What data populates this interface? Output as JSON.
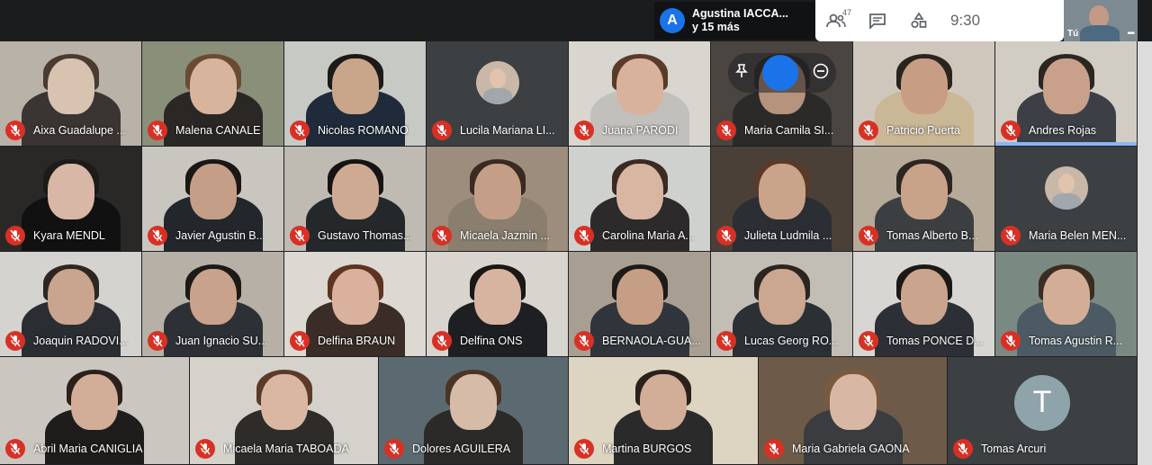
{
  "header": {
    "presenter_initial": "A",
    "presenter_name": "Agustina IACCA...",
    "presenter_more": "y 15 más",
    "participants_count": "47",
    "clock": "9:30",
    "self_label": "Tú",
    "self_more": "•••"
  },
  "hover_controls": {
    "pin_icon": "pin-icon",
    "mute_icon": "remove-circle-icon"
  },
  "participants": [
    {
      "name": "Aixa Guadalupe ..."
    },
    {
      "name": "Malena CANALE"
    },
    {
      "name": "Nicolas ROMANO"
    },
    {
      "name": "Lucila Mariana LI..."
    },
    {
      "name": "Juana PARODI"
    },
    {
      "name": "Maria Camila SI..."
    },
    {
      "name": "Patricio Puerta"
    },
    {
      "name": "Andres Rojas"
    },
    {
      "name": "Kyara MENDL"
    },
    {
      "name": "Javier Agustin B..."
    },
    {
      "name": "Gustavo Thomas..."
    },
    {
      "name": "Micaela Jazmin ..."
    },
    {
      "name": "Carolina Maria A..."
    },
    {
      "name": "Julieta Ludmila ..."
    },
    {
      "name": "Tomas Alberto B..."
    },
    {
      "name": "Maria Belen MEN..."
    },
    {
      "name": "Joaquin RADOVI..."
    },
    {
      "name": "Juan Ignacio SU..."
    },
    {
      "name": "Delfina BRAUN"
    },
    {
      "name": "Delfina ONS"
    },
    {
      "name": "BERNAOLA-GUA..."
    },
    {
      "name": "Lucas Georg RO..."
    },
    {
      "name": "Tomas PONCE D..."
    },
    {
      "name": "Tomas Agustin R..."
    },
    {
      "name": "Abril Maria CANIGLIA"
    },
    {
      "name": "Micaela Maria TABOADA"
    },
    {
      "name": "Dolores AGUILERA"
    },
    {
      "name": "Martina BURGOS"
    },
    {
      "name": "Maria Gabriela GAONA"
    },
    {
      "name": "Tomas Arcuri",
      "avatar_letter": "T"
    }
  ],
  "colors": {
    "mic_muted": "#d93025",
    "presenter_avatar": "#1a73e8",
    "speaking_indicator": "#8ab4f8",
    "background": "#202124"
  }
}
